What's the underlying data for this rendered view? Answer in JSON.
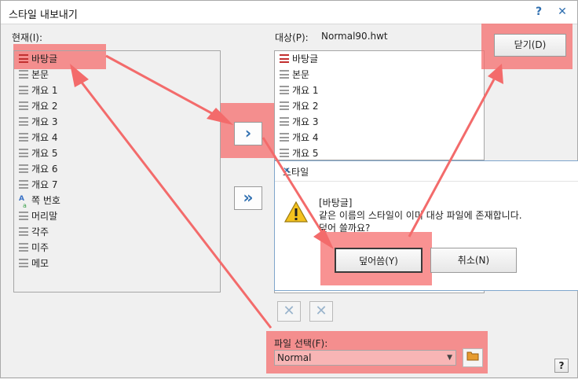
{
  "window": {
    "title": "스타일 내보내기",
    "help_glyph": "?",
    "close_glyph": "✕"
  },
  "left": {
    "label": "현재(I):",
    "items": [
      {
        "label": "바탕글",
        "icon": "style-checked-icon"
      },
      {
        "label": "본문",
        "icon": "style-icon"
      },
      {
        "label": "개요 1",
        "icon": "style-icon"
      },
      {
        "label": "개요 2",
        "icon": "style-icon"
      },
      {
        "label": "개요 3",
        "icon": "style-icon"
      },
      {
        "label": "개요 4",
        "icon": "style-icon"
      },
      {
        "label": "개요 5",
        "icon": "style-icon"
      },
      {
        "label": "개요 6",
        "icon": "style-icon"
      },
      {
        "label": "개요 7",
        "icon": "style-icon"
      },
      {
        "label": "쪽 번호",
        "icon": "char-style-icon"
      },
      {
        "label": "머리말",
        "icon": "style-icon"
      },
      {
        "label": "각주",
        "icon": "style-icon"
      },
      {
        "label": "미주",
        "icon": "style-icon"
      },
      {
        "label": "메모",
        "icon": "style-icon"
      }
    ]
  },
  "right": {
    "label": "대상(P):",
    "target_file": "Normal90.hwt",
    "items": [
      {
        "label": "바탕글",
        "icon": "style-checked-icon"
      },
      {
        "label": "본문",
        "icon": "style-icon"
      },
      {
        "label": "개요 1",
        "icon": "style-icon"
      },
      {
        "label": "개요 2",
        "icon": "style-icon"
      },
      {
        "label": "개요 3",
        "icon": "style-icon"
      },
      {
        "label": "개요 4",
        "icon": "style-icon"
      },
      {
        "label": "개요 5",
        "icon": "style-icon"
      }
    ]
  },
  "buttons": {
    "close_label": "닫기(D)",
    "copy_one_glyph": "›",
    "copy_all_glyph": "»",
    "delete_glyph": "✕"
  },
  "file_select": {
    "label": "파일 선택(F):",
    "value": "Normal"
  },
  "popup": {
    "title": "스타일",
    "close_glyph": "✕",
    "line1": "[바탕글]",
    "line2": "같은 이름의 스타일이 이미 대상 파일에 존재합니다.",
    "line3": "덮어 쓸까요?",
    "overwrite_label": "덮어씀(Y)",
    "cancel_label": "취소(N)"
  },
  "footer": {
    "help_glyph": "?"
  },
  "colors": {
    "highlight": "#f56e6e",
    "accent": "#2f6fb0",
    "check": "#c23030"
  }
}
